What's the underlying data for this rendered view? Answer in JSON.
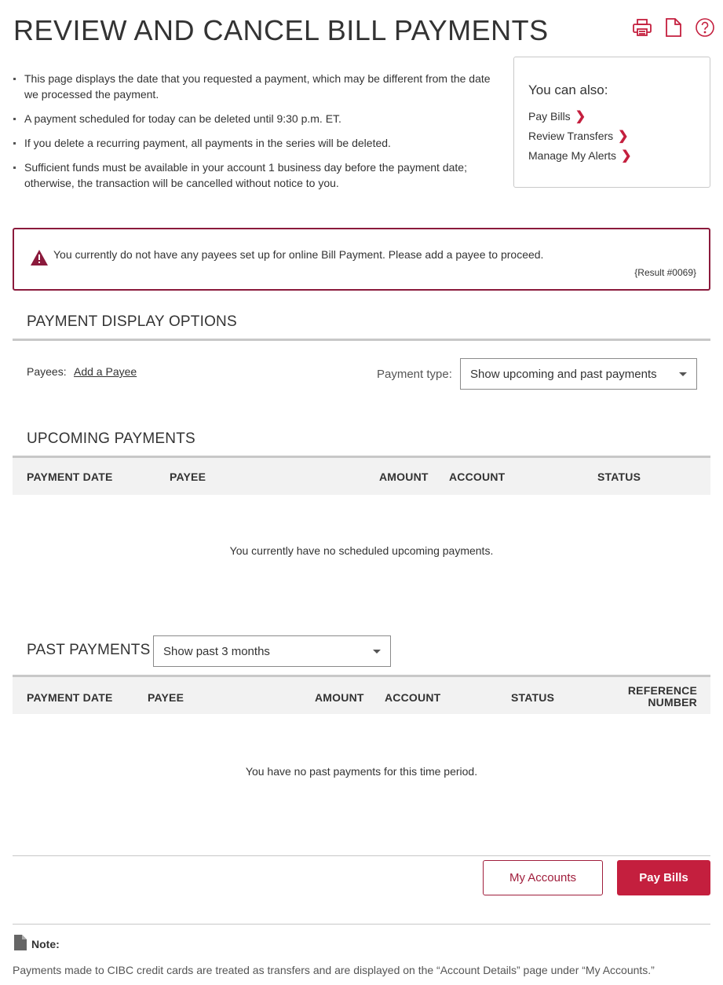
{
  "page": {
    "title": "REVIEW AND CANCEL BILL PAYMENTS",
    "tools": [
      {
        "icon": "print-icon",
        "label": "Print"
      },
      {
        "icon": "document-icon",
        "label": "Export"
      },
      {
        "icon": "help-icon",
        "label": "Help"
      }
    ]
  },
  "info": {
    "bullets": [
      "This page displays the date that you requested a payment, which may be different from the date we processed the payment.",
      "A payment scheduled for today can be deleted until 9:30 p.m. ET.",
      "If you delete a recurring payment, all payments in the series will be deleted.",
      "Sufficient funds must be available in your account 1 business day before the payment date; otherwise, the transaction will be cancelled without notice to you."
    ]
  },
  "also": {
    "title": "You can also:",
    "links": [
      "Pay Bills",
      "Review Transfers",
      "Manage My Alerts"
    ]
  },
  "alert": {
    "message": "You currently do not have any payees set up for online Bill Payment. Please add a payee to proceed.",
    "code": "{Result #0069}"
  },
  "display_options": {
    "title": "PAYMENT DISPLAY OPTIONS",
    "payees_label": "Payees:",
    "add_payee_link": "Add a Payee",
    "payment_type_label": "Payment type:",
    "payment_type_value": "Show upcoming and past payments"
  },
  "upcoming": {
    "title": "UPCOMING PAYMENTS",
    "columns": [
      "PAYMENT DATE",
      "PAYEE",
      "AMOUNT",
      "ACCOUNT",
      "STATUS"
    ],
    "empty_message": "You currently have no scheduled upcoming payments."
  },
  "past": {
    "title": "PAST PAYMENTS",
    "filter_value": "Show past 3 months",
    "columns": [
      "PAYMENT DATE",
      "PAYEE",
      "AMOUNT",
      "ACCOUNT",
      "STATUS",
      "REFERENCE",
      "NUMBER"
    ],
    "empty_message": "You have no past payments for this time period."
  },
  "actions": {
    "my_accounts": "My Accounts",
    "pay_bills": "Pay Bills"
  },
  "note": {
    "label": "Note:",
    "text": "Payments made to CIBC credit cards are treated as transfers and are displayed on the “Account Details” page under “My Accounts.”"
  },
  "colors": {
    "brand": "#c41f3e",
    "alert_border": "#8b1a3c"
  }
}
